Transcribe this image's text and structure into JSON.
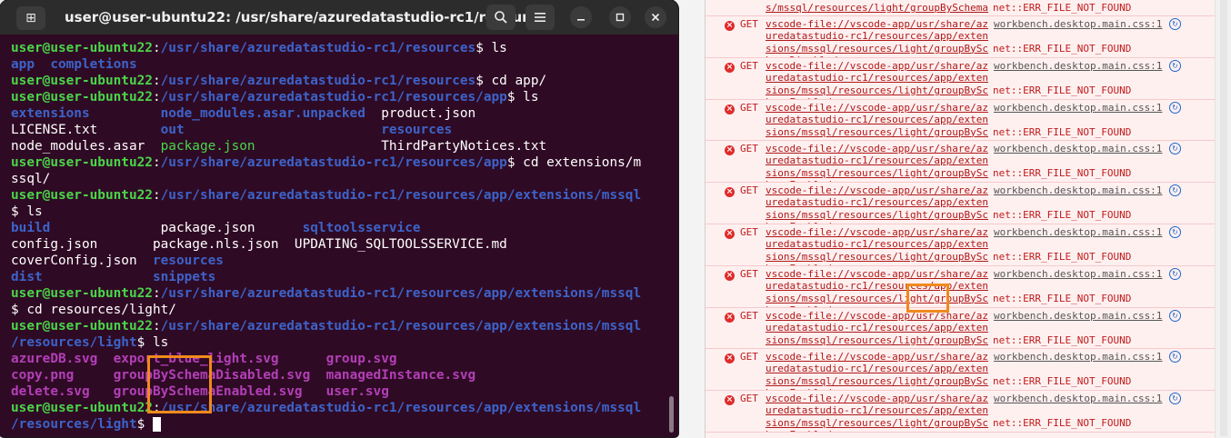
{
  "terminal": {
    "title": "user@user-ubuntu22: /usr/share/azuredatastudio-rc1/resourc...",
    "new_tab_icon": "new-tab-icon",
    "lines": [
      [
        {
          "t": "user@user-ubuntu22",
          "c": "usr"
        },
        {
          "t": ":",
          "c": "wht"
        },
        {
          "t": "/usr/share/azuredatastudio-rc1/resources",
          "c": "path"
        },
        {
          "t": "$ ls",
          "c": "wht"
        }
      ],
      [
        {
          "t": "app",
          "c": "dir"
        },
        {
          "t": "  ",
          "c": "wht"
        },
        {
          "t": "completions",
          "c": "dir"
        }
      ],
      [
        {
          "t": "user@user-ubuntu22",
          "c": "usr"
        },
        {
          "t": ":",
          "c": "wht"
        },
        {
          "t": "/usr/share/azuredatastudio-rc1/resources",
          "c": "path"
        },
        {
          "t": "$ cd app/",
          "c": "wht"
        }
      ],
      [
        {
          "t": "user@user-ubuntu22",
          "c": "usr"
        },
        {
          "t": ":",
          "c": "wht"
        },
        {
          "t": "/usr/share/azuredatastudio-rc1/resources/app",
          "c": "path"
        },
        {
          "t": "$ ls",
          "c": "wht"
        }
      ],
      [
        {
          "t": "extensions         ",
          "c": "dir"
        },
        {
          "t": "node_modules.asar.unpacked",
          "c": "dir"
        },
        {
          "t": "  product.json",
          "c": "wht"
        }
      ],
      [
        {
          "t": "LICENSE.txt        ",
          "c": "wht"
        },
        {
          "t": "out",
          "c": "dir"
        },
        {
          "t": "                         ",
          "c": "wht"
        },
        {
          "t": "resources",
          "c": "dir"
        }
      ],
      [
        {
          "t": "node_modules.asar  ",
          "c": "wht"
        },
        {
          "t": "package.json",
          "c": "exe"
        },
        {
          "t": "                ThirdPartyNotices.txt",
          "c": "wht"
        }
      ],
      [
        {
          "t": "user@user-ubuntu22",
          "c": "usr"
        },
        {
          "t": ":",
          "c": "wht"
        },
        {
          "t": "/usr/share/azuredatastudio-rc1/resources/app",
          "c": "path"
        },
        {
          "t": "$ cd extensions/m",
          "c": "wht"
        }
      ],
      [
        {
          "t": "ssql/",
          "c": "wht"
        }
      ],
      [
        {
          "t": "user@user-ubuntu22",
          "c": "usr"
        },
        {
          "t": ":",
          "c": "wht"
        },
        {
          "t": "/usr/share/azuredatastudio-rc1/resources/app/extensions/mssql",
          "c": "path"
        }
      ],
      [
        {
          "t": "$ ls",
          "c": "wht"
        }
      ],
      [
        {
          "t": "build",
          "c": "dir"
        },
        {
          "t": "              package.json      ",
          "c": "wht"
        },
        {
          "t": "sqltoolsservice",
          "c": "dir"
        }
      ],
      [
        {
          "t": "config.json       package.nls.json  UPDATING_SQLTOOLSSERVICE.md",
          "c": "wht"
        }
      ],
      [
        {
          "t": "coverConfig.json  ",
          "c": "wht"
        },
        {
          "t": "resources",
          "c": "dir"
        }
      ],
      [
        {
          "t": "dist",
          "c": "dir"
        },
        {
          "t": "              ",
          "c": "wht"
        },
        {
          "t": "snippets",
          "c": "dir"
        }
      ],
      [
        {
          "t": "user@user-ubuntu22",
          "c": "usr"
        },
        {
          "t": ":",
          "c": "wht"
        },
        {
          "t": "/usr/share/azuredatastudio-rc1/resources/app/extensions/mssql",
          "c": "path"
        }
      ],
      [
        {
          "t": "$ cd resources/light/",
          "c": "wht"
        }
      ],
      [
        {
          "t": "user@user-ubuntu22",
          "c": "usr"
        },
        {
          "t": ":",
          "c": "wht"
        },
        {
          "t": "/usr/share/azuredatastudio-rc1/resources/app/extensions/mssql",
          "c": "path"
        }
      ],
      [
        {
          "t": "/resources/light",
          "c": "path"
        },
        {
          "t": "$ ls",
          "c": "wht"
        }
      ],
      [
        {
          "t": "azureDB.svg",
          "c": "img"
        },
        {
          "t": "  ",
          "c": "wht"
        },
        {
          "t": "export_blue_light.svg",
          "c": "img"
        },
        {
          "t": "      ",
          "c": "wht"
        },
        {
          "t": "group.svg",
          "c": "img"
        }
      ],
      [
        {
          "t": "copy.png",
          "c": "img"
        },
        {
          "t": "     ",
          "c": "wht"
        },
        {
          "t": "groupBySchemaDisabled.svg",
          "c": "img"
        },
        {
          "t": "  ",
          "c": "wht"
        },
        {
          "t": "managedInstance.svg",
          "c": "img"
        }
      ],
      [
        {
          "t": "delete.svg",
          "c": "img"
        },
        {
          "t": "   ",
          "c": "wht"
        },
        {
          "t": "groupBySchemaEnabled.svg",
          "c": "img"
        },
        {
          "t": "   ",
          "c": "wht"
        },
        {
          "t": "user.svg",
          "c": "img"
        }
      ],
      [
        {
          "t": "user@user-ubuntu22",
          "c": "usr"
        },
        {
          "t": ":",
          "c": "wht"
        },
        {
          "t": "/usr/share/azuredatastudio-rc1/resources/app/extensions/mssql",
          "c": "path"
        }
      ],
      [
        {
          "t": "/resources/light",
          "c": "path"
        },
        {
          "t": "$ ",
          "c": "wht"
        },
        {
          "t": " ",
          "c": "cur"
        }
      ]
    ]
  },
  "console": {
    "top": {
      "url": "s/mssql/resources/light/groupBySchemaDisabled.svg",
      "error": "net::ERR_FILE_NOT_FOUND"
    },
    "entries": [
      {
        "method": "GET",
        "url": "vscode-file://vscode-app/usr/share/azuredatastudio-rc1/resources/app/extensions/mssql/resources/light/groupBySchemaDisabled.svg",
        "source": "workbench.desktop.main.css:1",
        "error": "net::ERR_FILE_NOT_FOUND"
      },
      {
        "method": "GET",
        "url": "vscode-file://vscode-app/usr/share/azuredatastudio-rc1/resources/app/extensions/mssql/resources/light/groupBySchemaEnabled.svg",
        "source": "workbench.desktop.main.css:1",
        "error": "net::ERR_FILE_NOT_FOUND"
      },
      {
        "method": "GET",
        "url": "vscode-file://vscode-app/usr/share/azuredatastudio-rc1/resources/app/extensions/mssql/resources/light/groupBySchemaEnabled.svg",
        "source": "workbench.desktop.main.css:1",
        "error": "net::ERR_FILE_NOT_FOUND"
      },
      {
        "method": "GET",
        "url": "vscode-file://vscode-app/usr/share/azuredatastudio-rc1/resources/app/extensions/mssql/resources/light/groupBySchemaEnabled.svg",
        "source": "workbench.desktop.main.css:1",
        "error": "net::ERR_FILE_NOT_FOUND"
      },
      {
        "method": "GET",
        "url": "vscode-file://vscode-app/usr/share/azuredatastudio-rc1/resources/app/extensions/mssql/resources/light/groupBySchemaEnabled.svg",
        "source": "workbench.desktop.main.css:1",
        "error": "net::ERR_FILE_NOT_FOUND"
      },
      {
        "method": "GET",
        "url": "vscode-file://vscode-app/usr/share/azuredatastudio-rc1/resources/app/extensions/mssql/resources/light/groupBySchemaEnabled.svg",
        "source": "workbench.desktop.main.css:1",
        "error": "net::ERR_FILE_NOT_FOUND"
      },
      {
        "method": "GET",
        "url": "vscode-file://vscode-app/usr/share/azuredatastudio-rc1/resources/app/extensions/mssql/resources/light/groupBySchemaEnabled.svg",
        "source": "workbench.desktop.main.css:1",
        "error": "net::ERR_FILE_NOT_FOUND"
      },
      {
        "method": "GET",
        "url": "vscode-file://vscode-app/usr/share/azuredatastudio-rc1/resources/app/extensions/mssql/resources/light/groupBySchemaEnabled.svg",
        "source": "workbench.desktop.main.css:1",
        "error": "net::ERR_FILE_NOT_FOUND"
      },
      {
        "method": "GET",
        "url": "vscode-file://vscode-app/usr/share/azuredatastudio-rc1/resources/app/extensions/mssql/resources/light/groupBySchemaEnabled.svg",
        "source": "workbench.desktop.main.css:1",
        "error": "net::ERR_FILE_NOT_FOUND"
      },
      {
        "method": "GET",
        "url": "vscode-file://vscode-app/usr/share/azuredatastudio-rc1/resources/app/extensions/mssql/resources/light/groupBySchemaEnabled.svg",
        "source": "workbench.desktop.main.css:1",
        "error": "net::ERR_FILE_NOT_FOUND"
      }
    ]
  },
  "colors": {
    "highlight": "#f08a1c",
    "terminal_bg": "#2f0a24",
    "prompt_user": "#4ad54a",
    "prompt_path": "#3d63c9",
    "error_red": "#c01b1b"
  }
}
